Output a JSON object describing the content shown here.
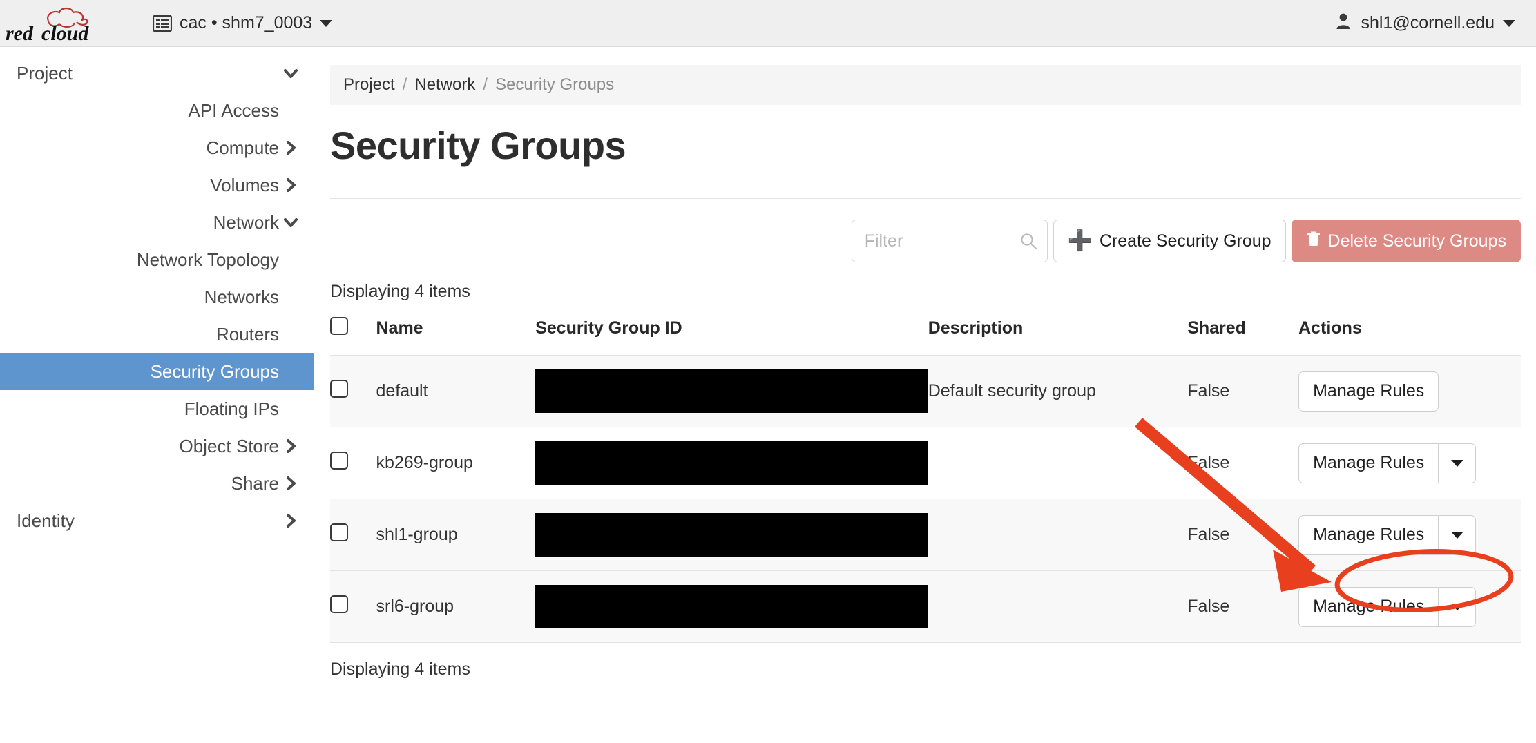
{
  "topbar": {
    "logo_text": "red cloud",
    "context_icon": "table-list-icon",
    "context_label": "cac • shm7_0003",
    "user_icon": "user-icon",
    "user_label": "shl1@cornell.edu"
  },
  "sidebar": {
    "items": [
      {
        "label": "Project",
        "level": 0,
        "chevron": "chevron-down",
        "active": false
      },
      {
        "label": "API Access",
        "level": 2,
        "chevron": "none",
        "active": false
      },
      {
        "label": "Compute",
        "level": 1,
        "chevron": "chevron-right",
        "active": false
      },
      {
        "label": "Volumes",
        "level": 1,
        "chevron": "chevron-right",
        "active": false
      },
      {
        "label": "Network",
        "level": 1,
        "chevron": "chevron-down",
        "active": false
      },
      {
        "label": "Network Topology",
        "level": 2,
        "chevron": "none",
        "active": false
      },
      {
        "label": "Networks",
        "level": 2,
        "chevron": "none",
        "active": false
      },
      {
        "label": "Routers",
        "level": 2,
        "chevron": "none",
        "active": false
      },
      {
        "label": "Security Groups",
        "level": 2,
        "chevron": "none",
        "active": true
      },
      {
        "label": "Floating IPs",
        "level": 2,
        "chevron": "none",
        "active": false
      },
      {
        "label": "Object Store",
        "level": 1,
        "chevron": "chevron-right",
        "active": false
      },
      {
        "label": "Share",
        "level": 1,
        "chevron": "chevron-right",
        "active": false
      },
      {
        "label": "Identity",
        "level": 0,
        "chevron": "chevron-right",
        "active": false
      }
    ],
    "active_bg": "#5e95cf"
  },
  "breadcrumb": {
    "items": [
      "Project",
      "Network",
      "Security Groups"
    ],
    "separator": "/"
  },
  "page": {
    "title": "Security Groups",
    "count_top": "Displaying 4 items",
    "count_bottom": "Displaying 4 items"
  },
  "toolbar": {
    "filter_placeholder": "Filter",
    "filter_value": "",
    "search_icon": "search-icon",
    "create_label": "Create Security Group",
    "create_icon": "plus-icon",
    "delete_label": "Delete Security Groups",
    "delete_icon": "trash-icon",
    "delete_bg": "#dd8a84"
  },
  "table": {
    "columns": [
      "",
      "Name",
      "Security Group ID",
      "Description",
      "Shared",
      "Actions"
    ],
    "action_label": "Manage Rules",
    "rows": [
      {
        "name": "default",
        "security_group_id": "[redacted]",
        "description": "Default security group",
        "shared": "False",
        "action": "Manage Rules",
        "has_caret": false
      },
      {
        "name": "kb269-group",
        "security_group_id": "[redacted]",
        "description": "",
        "shared": "False",
        "action": "Manage Rules",
        "has_caret": true
      },
      {
        "name": "shl1-group",
        "security_group_id": "[redacted]",
        "description": "",
        "shared": "False",
        "action": "Manage Rules",
        "has_caret": true
      },
      {
        "name": "srl6-group",
        "security_group_id": "[redacted]",
        "description": "",
        "shared": "False",
        "action": "Manage Rules",
        "has_caret": true
      }
    ]
  },
  "annotation": {
    "color": "#e8401f",
    "arrow": "red-arrow-pointing-down-right",
    "ellipse": "red-ellipse-highlight-around-manage-rules-row-3"
  }
}
